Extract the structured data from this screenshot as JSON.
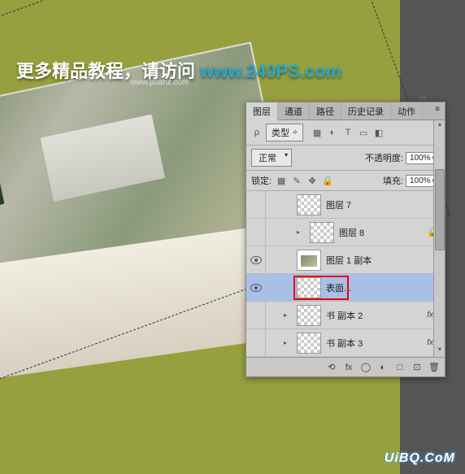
{
  "watermark": {
    "top_text": "更多精品教程，请访问 ",
    "top_link": "www.240PS.com",
    "psahz": "www.psahz.com",
    "bottom": "UiBQ.CoM"
  },
  "panel": {
    "tabs": [
      "图层",
      "通道",
      "路径",
      "历史记录",
      "动作"
    ],
    "active_tab": 0,
    "menu_icon": "≡",
    "filter": {
      "search_icon": "ρ",
      "mode": "类型",
      "dropdown_icon": "÷",
      "icon_labels": [
        "image-filter-icon",
        "adjust-filter-icon",
        "text-filter-icon",
        "shape-filter-icon",
        "smart-filter-icon"
      ],
      "icon_glyphs": [
        "▦",
        "◐",
        "T",
        "▭",
        "◧"
      ]
    },
    "blend": {
      "mode": "正常",
      "opacity_label": "不透明度:",
      "opacity_value": "100%"
    },
    "lock": {
      "label": "锁定:",
      "icons": [
        "▦",
        "✎",
        "✥",
        "🔒"
      ],
      "fill_label": "填充:",
      "fill_value": "100%"
    },
    "layers": [
      {
        "visible": false,
        "indent": 1,
        "disclosure": "",
        "thumb": "checker",
        "name": "图层 7",
        "fx": false,
        "locked": false
      },
      {
        "visible": false,
        "indent": 2,
        "disclosure": "▸",
        "thumb": "checker",
        "name": "图层 8",
        "fx": false,
        "locked": true
      },
      {
        "visible": true,
        "indent": 1,
        "disclosure": "",
        "thumb": "bench",
        "name": "图层 1 副本",
        "fx": false,
        "locked": false
      },
      {
        "visible": true,
        "indent": 1,
        "disclosure": "",
        "thumb": "checker",
        "name": "表面...",
        "fx": false,
        "locked": false,
        "selected": true,
        "highlighted": true
      },
      {
        "visible": false,
        "indent": 1,
        "disclosure": "▸",
        "thumb": "checker",
        "name": "书 副本 2",
        "fx": true,
        "locked": false
      },
      {
        "visible": false,
        "indent": 1,
        "disclosure": "▸",
        "thumb": "checker",
        "name": "书 副本 3",
        "fx": true,
        "locked": false
      }
    ],
    "bottom_icons": {
      "labels": [
        "link-layers-icon",
        "fx-icon",
        "mask-icon",
        "adjustment-icon",
        "group-icon",
        "new-layer-icon",
        "delete-icon"
      ],
      "glyphs": [
        "⟲",
        "fx",
        "◯",
        "◐",
        "□",
        "⊡",
        "🗑"
      ]
    }
  }
}
